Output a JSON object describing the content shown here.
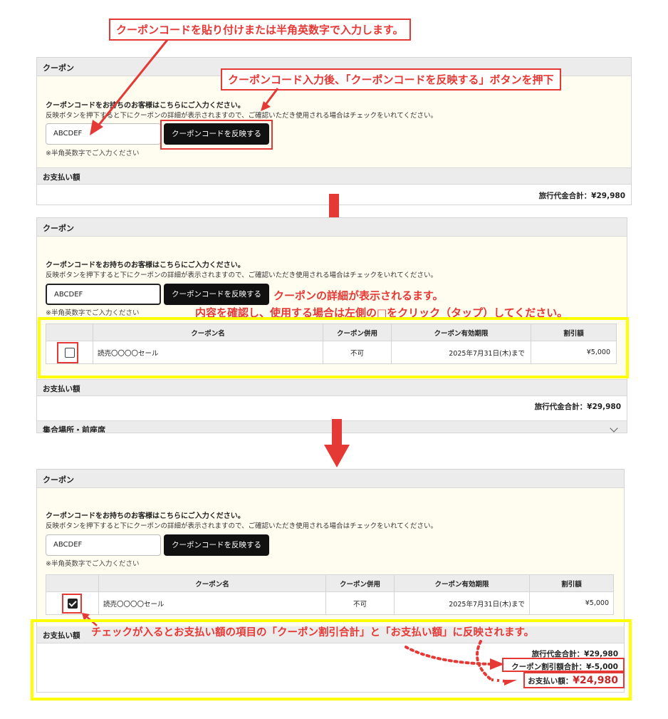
{
  "annotations": {
    "top_callout": "クーポンコードを貼り付けまたは半角英数字で入力します。",
    "apply_callout": "クーポンコード入力後、「クーポンコードを反映する」ボタンを押下",
    "detail_line1": "クーポンの詳細が表示されるます。",
    "detail_line2": "内容を確認し、使用する場合は左側の□をクリック（タップ）してください。",
    "reflect_note": "チェックが入るとお支払い額の項目の「クーポン割引合計」と「お支払い額」に反映されます。"
  },
  "coupon_section": {
    "header": "クーポン",
    "intro_title": "クーポンコードをお持ちのお客様はこちらにご入力ください。",
    "intro_desc": "反映ボタンを押下すると下にクーポンの詳細が表示されますので、ご確認いただき使用される場合はチェックをいれてください。",
    "code_value": "ABCDEF",
    "apply_label": "クーポンコードを反映する",
    "hint": "※半角英数字でご入力ください"
  },
  "coupon_table": {
    "headers": [
      "クーポン名",
      "クーポン併用",
      "クーポン有効期限",
      "割引額"
    ],
    "row": {
      "name": "読売〇〇〇〇セール",
      "combine": "不可",
      "expiry": "2025年7月31日(木)まで",
      "discount": "¥5,000"
    }
  },
  "payment": {
    "header": "お支払い額",
    "total_label": "旅行代金合計：",
    "total_value": "¥29,980",
    "discount_label": "クーポン割引額合計：",
    "discount_value": "¥-5,000",
    "pay_label": "お支払い額：",
    "pay_value": "¥24,980"
  },
  "meeting_section": {
    "header": "集合場所・前座席"
  },
  "colors": {
    "annotation_red": "#e53935",
    "highlight_yellow": "#ffff00",
    "panel_bg": "#fffdf0",
    "header_bg": "#ececec",
    "button_bg": "#111111"
  }
}
